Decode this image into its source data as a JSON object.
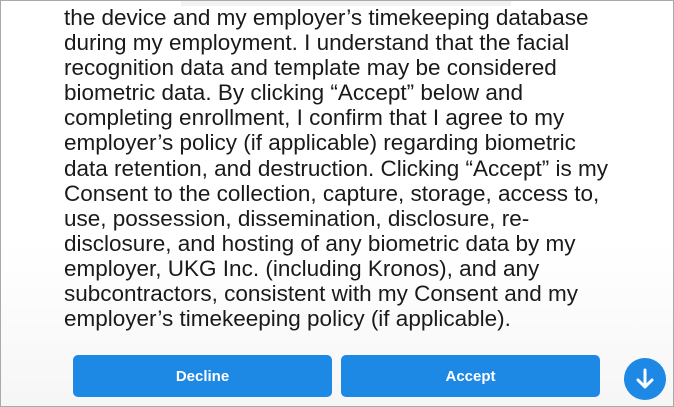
{
  "consent": {
    "lines": [
      "the device and my employer’s timekeeping database",
      "during my employment. I understand that the facial",
      "recognition data and template may be considered",
      "biometric data.  By clicking “Accept” below and",
      "completing enrollment, I confirm that I agree to my",
      "employer’s policy (if applicable) regarding biometric",
      "data retention, and destruction.  Clicking “Accept” is my",
      "Consent to the collection, capture, storage, access to,",
      "use, possession, dissemination, disclosure, re-",
      "disclosure, and hosting of any biometric data by my",
      "employer, UKG Inc. (including Kronos), and any",
      "subcontractors, consistent with my Consent and my",
      "employer’s timekeeping policy (if applicable)."
    ]
  },
  "actions": {
    "decline_label": "Decline",
    "accept_label": "Accept",
    "scroll_icon": "arrow-down-icon"
  },
  "colors": {
    "accent": "#1e88e5",
    "text": "#1a1a1a",
    "border": "#a9a9a9"
  }
}
